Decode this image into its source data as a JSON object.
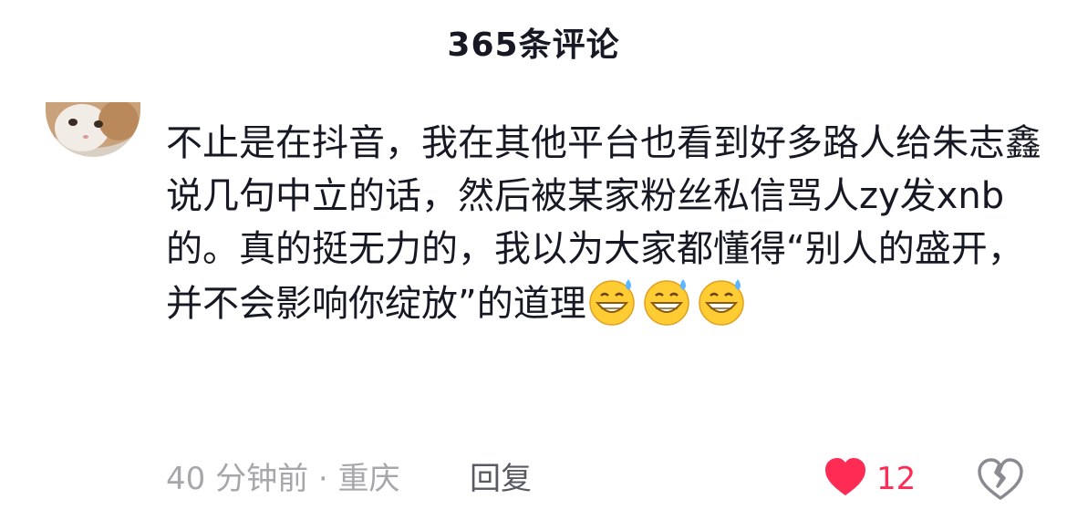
{
  "header": {
    "title": "365条评论"
  },
  "comment": {
    "text": "不止是在抖音，我在其他平台也看到好多路人给朱志鑫说几句中立的话，然后被某家粉丝私信骂人zy发xnb的。真的挺无力的，我以为大家都懂得“别人的盛开，并不会影响你绽放”的道理",
    "emojis": [
      "grinning-sweat-emoji",
      "grinning-sweat-emoji",
      "grinning-sweat-emoji"
    ],
    "meta": "40 分钟前 · 重庆",
    "reply_label": "回复",
    "like_count": "12"
  },
  "colors": {
    "text": "#161823",
    "meta": "#a6a7ab",
    "like": "#fe2c55"
  }
}
